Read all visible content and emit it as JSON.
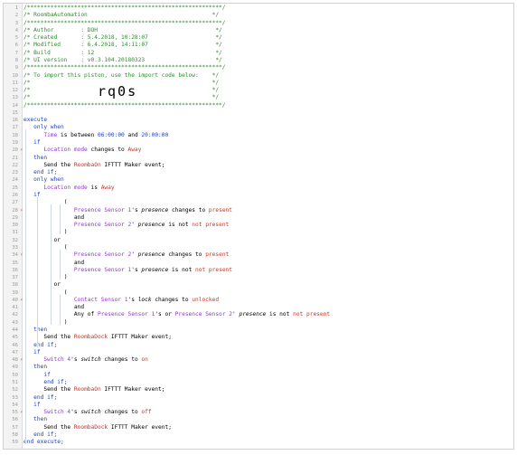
{
  "lines": [
    {
      "n": "1",
      "seg": [
        {
          "t": "/**********************************************************/",
          "c": "cm"
        }
      ]
    },
    {
      "n": "2",
      "seg": [
        {
          "t": "/* RoombaAutomation                                     */",
          "c": "cm"
        }
      ]
    },
    {
      "n": "3",
      "seg": [
        {
          "t": "/**********************************************************/",
          "c": "cm"
        }
      ]
    },
    {
      "n": "4",
      "seg": [
        {
          "t": "/* Author        : DOH                                   */",
          "c": "cm"
        }
      ]
    },
    {
      "n": "5",
      "seg": [
        {
          "t": "/* Created       : 5.4.2018, 10:28:07                    */",
          "c": "cm"
        }
      ]
    },
    {
      "n": "6",
      "seg": [
        {
          "t": "/* Modified      : 6.4.2018, 14:11:07                    */",
          "c": "cm"
        }
      ]
    },
    {
      "n": "7",
      "seg": [
        {
          "t": "/* Build         : 12                                    */",
          "c": "cm"
        }
      ]
    },
    {
      "n": "8",
      "seg": [
        {
          "t": "/* UI version    : v0.3.104.20180323                     */",
          "c": "cm"
        }
      ]
    },
    {
      "n": "9",
      "seg": [
        {
          "t": "/**********************************************************/",
          "c": "cm"
        }
      ]
    },
    {
      "n": "10",
      "seg": [
        {
          "t": "/* To import this piston, use the import code below:    */",
          "c": "cm"
        }
      ]
    },
    {
      "n": "11",
      "seg": [
        {
          "t": "/*                                                      */",
          "c": "cm"
        }
      ]
    },
    {
      "n": "12",
      "seg": [
        {
          "t": "/*                                                      */",
          "c": "cm"
        }
      ]
    },
    {
      "n": "13",
      "seg": [
        {
          "t": "/*                                                      */",
          "c": "cm"
        }
      ]
    },
    {
      "n": "14",
      "seg": [
        {
          "t": "/**********************************************************/",
          "c": "cm"
        }
      ]
    },
    {
      "n": "15",
      "seg": []
    },
    {
      "n": "16",
      "seg": [
        {
          "t": "execute",
          "c": "kw"
        }
      ]
    },
    {
      "n": "17",
      "seg": [
        {
          "t": "   only when",
          "c": "kw"
        }
      ]
    },
    {
      "n": "18",
      "seg": [
        {
          "t": "      Time",
          "c": "dv"
        },
        {
          "t": " is between "
        },
        {
          "t": "06:00:00",
          "c": "kw"
        },
        {
          "t": " and "
        },
        {
          "t": "20:00:00",
          "c": "kw"
        }
      ]
    },
    {
      "n": "19",
      "seg": [
        {
          "t": "   if",
          "c": "kw"
        }
      ]
    },
    {
      "n": "20",
      "seg": [
        {
          "t": "      Location mode",
          "c": "dv"
        },
        {
          "t": " changes to "
        },
        {
          "t": "Away",
          "c": "cx"
        }
      ],
      "mark": true
    },
    {
      "n": "21",
      "seg": [
        {
          "t": "   then",
          "c": "kw"
        }
      ]
    },
    {
      "n": "22",
      "seg": [
        {
          "t": "      Send the "
        },
        {
          "t": "RoombaOn",
          "c": "cx"
        },
        {
          "t": " IFTTT Maker event;"
        }
      ]
    },
    {
      "n": "23",
      "seg": [
        {
          "t": "   end if;",
          "c": "kw"
        }
      ]
    },
    {
      "n": "24",
      "seg": [
        {
          "t": "   only when",
          "c": "kw"
        }
      ]
    },
    {
      "n": "25",
      "seg": [
        {
          "t": "      Location mode",
          "c": "dv"
        },
        {
          "t": " is "
        },
        {
          "t": "Away",
          "c": "cx"
        }
      ]
    },
    {
      "n": "26",
      "seg": [
        {
          "t": "   if",
          "c": "kw"
        }
      ]
    },
    {
      "n": "27",
      "seg": [
        {
          "t": "            ("
        }
      ]
    },
    {
      "n": "28",
      "seg": [
        {
          "t": "               Presence Sensor 1",
          "c": "dv"
        },
        {
          "t": "'s "
        },
        {
          "t": "presence",
          "c": "it"
        },
        {
          "t": " changes to "
        },
        {
          "t": "present",
          "c": "cx"
        }
      ],
      "mark": true
    },
    {
      "n": "29",
      "seg": [
        {
          "t": "               and"
        }
      ]
    },
    {
      "n": "30",
      "seg": [
        {
          "t": "               Presence Sensor 2",
          "c": "dv"
        },
        {
          "t": "' "
        },
        {
          "t": "presence",
          "c": "it"
        },
        {
          "t": " is not "
        },
        {
          "t": "not present",
          "c": "cx"
        }
      ]
    },
    {
      "n": "31",
      "seg": [
        {
          "t": "            )"
        }
      ]
    },
    {
      "n": "32",
      "seg": [
        {
          "t": "         or"
        }
      ]
    },
    {
      "n": "33",
      "seg": [
        {
          "t": "            ("
        }
      ]
    },
    {
      "n": "34",
      "seg": [
        {
          "t": "               Presence Sensor 2",
          "c": "dv"
        },
        {
          "t": "' "
        },
        {
          "t": "presence",
          "c": "it"
        },
        {
          "t": " changes to "
        },
        {
          "t": "present",
          "c": "cx"
        }
      ],
      "mark": true
    },
    {
      "n": "35",
      "seg": [
        {
          "t": "               and"
        }
      ]
    },
    {
      "n": "36",
      "seg": [
        {
          "t": "               Presence Sensor 1",
          "c": "dv"
        },
        {
          "t": "'s "
        },
        {
          "t": "presence",
          "c": "it"
        },
        {
          "t": " is not "
        },
        {
          "t": "not present",
          "c": "cx"
        }
      ]
    },
    {
      "n": "37",
      "seg": [
        {
          "t": "            )"
        }
      ]
    },
    {
      "n": "38",
      "seg": [
        {
          "t": "         or"
        }
      ]
    },
    {
      "n": "39",
      "seg": [
        {
          "t": "            ("
        }
      ]
    },
    {
      "n": "40",
      "seg": [
        {
          "t": "               Contact Sensor 1",
          "c": "dv"
        },
        {
          "t": "'s "
        },
        {
          "t": "lock",
          "c": "it"
        },
        {
          "t": " changes to "
        },
        {
          "t": "unlocked",
          "c": "cx"
        }
      ],
      "mark": true
    },
    {
      "n": "41",
      "seg": [
        {
          "t": "               and"
        }
      ]
    },
    {
      "n": "42",
      "seg": [
        {
          "t": "               Any of "
        },
        {
          "t": "Presence Sensor 1",
          "c": "dv"
        },
        {
          "t": "'s or "
        },
        {
          "t": "Presence Sensor 2",
          "c": "dv"
        },
        {
          "t": "' "
        },
        {
          "t": "presence",
          "c": "it"
        },
        {
          "t": " is not "
        },
        {
          "t": "not present",
          "c": "cx"
        }
      ]
    },
    {
      "n": "43",
      "seg": [
        {
          "t": "            )"
        }
      ]
    },
    {
      "n": "44",
      "seg": [
        {
          "t": "   then",
          "c": "kw"
        }
      ]
    },
    {
      "n": "45",
      "seg": [
        {
          "t": "      Send the "
        },
        {
          "t": "RoombaDock",
          "c": "cx"
        },
        {
          "t": " IFTTT Maker event;"
        }
      ]
    },
    {
      "n": "46",
      "seg": [
        {
          "t": "   end if;",
          "c": "kw"
        }
      ]
    },
    {
      "n": "47",
      "seg": [
        {
          "t": "   if",
          "c": "kw"
        }
      ]
    },
    {
      "n": "48",
      "seg": [
        {
          "t": "      Switch 4",
          "c": "dv"
        },
        {
          "t": "'s "
        },
        {
          "t": "switch",
          "c": "it"
        },
        {
          "t": " changes to "
        },
        {
          "t": "on",
          "c": "cx"
        }
      ],
      "mark": true
    },
    {
      "n": "49",
      "seg": [
        {
          "t": "   then",
          "c": "kw"
        }
      ]
    },
    {
      "n": "50",
      "seg": [
        {
          "t": "      if",
          "c": "kw"
        }
      ]
    },
    {
      "n": "51",
      "seg": [
        {
          "t": "      end if;",
          "c": "kw"
        }
      ]
    },
    {
      "n": "52",
      "seg": [
        {
          "t": "      Send the "
        },
        {
          "t": "RoombaOn",
          "c": "cx"
        },
        {
          "t": " IFTTT Maker event;"
        }
      ]
    },
    {
      "n": "53",
      "seg": [
        {
          "t": "   end if;",
          "c": "kw"
        }
      ]
    },
    {
      "n": "54",
      "seg": [
        {
          "t": "   if",
          "c": "kw"
        }
      ]
    },
    {
      "n": "55",
      "seg": [
        {
          "t": "      Switch 4",
          "c": "dv"
        },
        {
          "t": "'s "
        },
        {
          "t": "switch",
          "c": "it"
        },
        {
          "t": " changes to "
        },
        {
          "t": "off",
          "c": "cx"
        }
      ],
      "mark": true
    },
    {
      "n": "56",
      "seg": [
        {
          "t": "   then",
          "c": "kw"
        }
      ]
    },
    {
      "n": "57",
      "seg": [
        {
          "t": "      Send the "
        },
        {
          "t": "RoombaDock",
          "c": "cx"
        },
        {
          "t": " IFTTT Maker event;"
        }
      ]
    },
    {
      "n": "58",
      "seg": [
        {
          "t": "   end if;",
          "c": "kw"
        }
      ]
    },
    {
      "n": "59",
      "seg": [
        {
          "t": "end execute;",
          "c": "kw"
        }
      ]
    }
  ],
  "import_code": "rq0s",
  "gutter_mark": "⚡",
  "colors": {
    "comment": "#2f8c2f",
    "keyword": "#1a3fd1",
    "constant": "#c0392b",
    "device": "#8e3bc4"
  }
}
